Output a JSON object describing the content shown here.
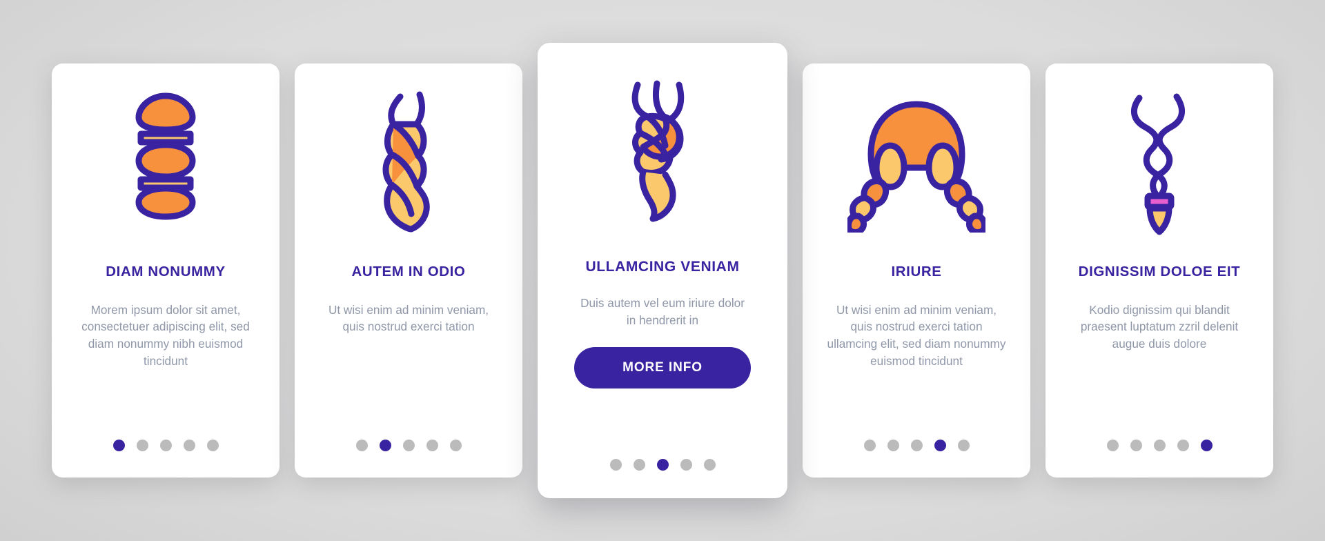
{
  "theme": {
    "accent_purple": "#3A23A0",
    "accent_orange": "#F7913D",
    "accent_yellow": "#FBC96B",
    "body_text_gray": "#8F97A8",
    "dot_inactive_gray": "#BBBBBB",
    "card_background": "#FFFFFF",
    "page_background": "#D3D3D3"
  },
  "cards": [
    {
      "icon_name": "braid-beads-strand-icon",
      "title": "DIAM NONUMMY",
      "body": "Morem ipsum dolor sit amet, consectetuer adipiscing elit, sed diam nonummy nibh euismod tincidunt",
      "dots_total": 5,
      "dot_active_index": 1,
      "featured": false,
      "cta_label": ""
    },
    {
      "icon_name": "twisted-rope-braid-icon",
      "title": "AUTEM IN ODIO",
      "body": "Ut wisi enim ad minim veniam, quis nostrud exerci tation",
      "dots_total": 5,
      "dot_active_index": 2,
      "featured": false,
      "cta_label": ""
    },
    {
      "icon_name": "three-strand-knot-braid-icon",
      "title": "ULLAMCING VENIAM",
      "body": "Duis autem vel eum iriure dolor in hendrerit in",
      "dots_total": 5,
      "dot_active_index": 3,
      "featured": true,
      "cta_label": "MORE INFO"
    },
    {
      "icon_name": "pigtail-braids-hairstyle-icon",
      "title": "IRIURE",
      "body": "Ut wisi enim ad minim veniam, quis nostrud exerci tation ullamcing elit, sed diam nonummy euismod tincidunt",
      "dots_total": 5,
      "dot_active_index": 4,
      "featured": false,
      "cta_label": ""
    },
    {
      "icon_name": "twisted-lock-hair-tie-icon",
      "title": "DIGNISSIM DOLOE EIT",
      "body": "Kodio dignissim qui blandit praesent luptatum zzril delenit augue duis dolore",
      "dots_total": 5,
      "dot_active_index": 5,
      "featured": false,
      "cta_label": ""
    }
  ]
}
